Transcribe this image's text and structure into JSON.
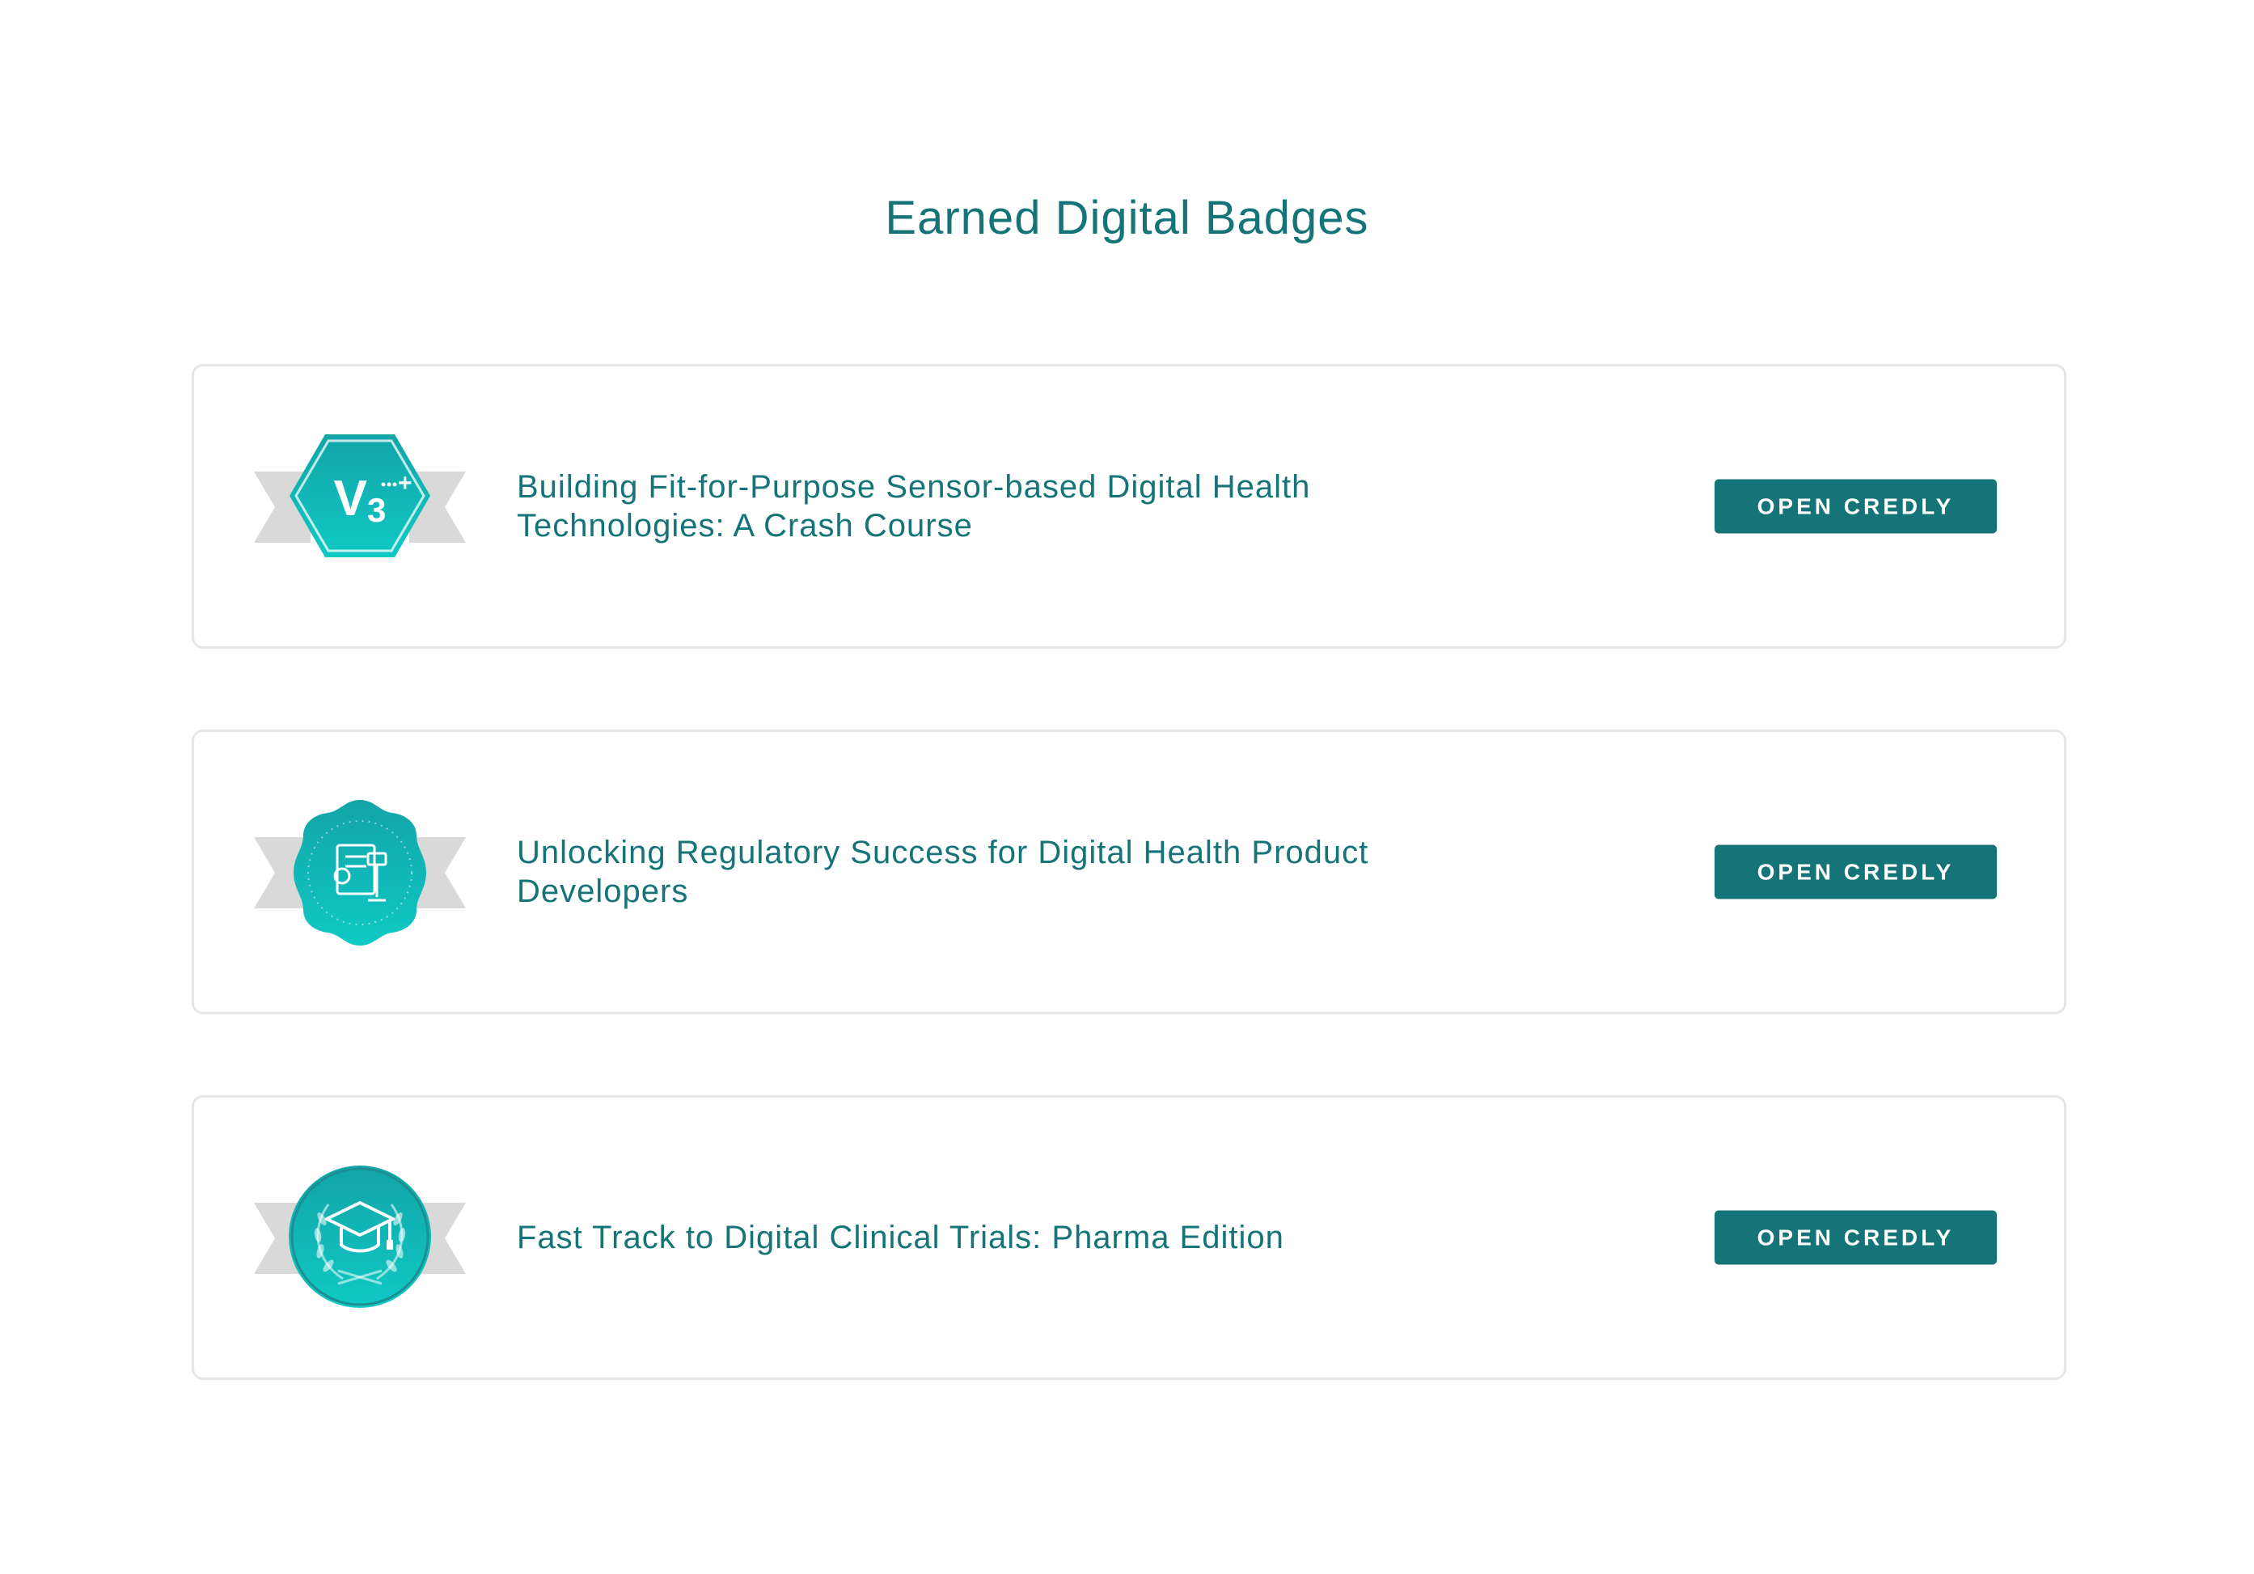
{
  "page": {
    "title": "Earned Digital Badges"
  },
  "badges": [
    {
      "title": "Building Fit-for-Purpose Sensor-based Digital Health Technologies: A Crash Course",
      "icon": "v3-plus-hexagon-badge-icon",
      "button_label": "OPEN CREDLY"
    },
    {
      "title": "Unlocking Regulatory Success for Digital Health Product Developers",
      "icon": "regulatory-seal-badge-icon",
      "button_label": "OPEN CREDLY"
    },
    {
      "title": "Fast Track to Digital Clinical Trials: Pharma Edition",
      "icon": "graduation-cap-laurel-badge-icon",
      "button_label": "OPEN CREDLY"
    }
  ],
  "colors": {
    "accent": "#157478",
    "badge_gradient_top": "#13a4a8",
    "badge_gradient_bottom": "#0fc9c4",
    "ribbon": "#d9d9d9",
    "card_border": "#e6e6e6"
  }
}
